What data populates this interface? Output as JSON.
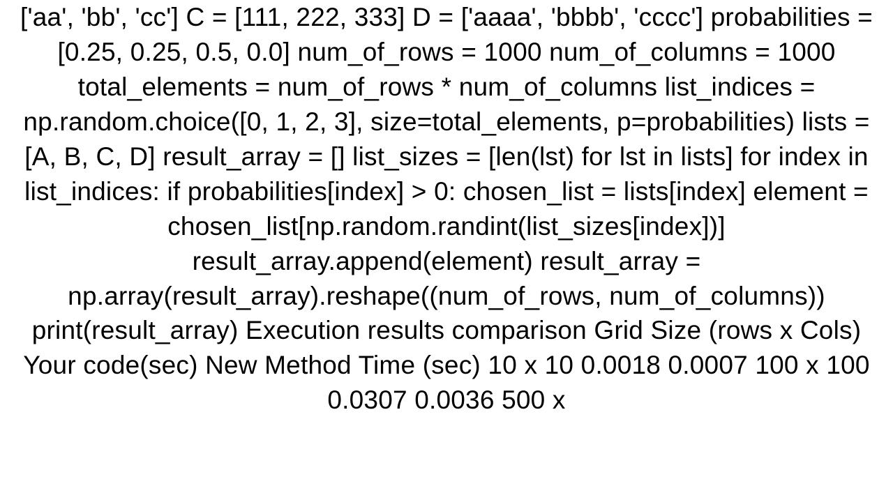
{
  "document": {
    "text": "['aa', 'bb', 'cc'] C = [111, 222, 333] D = ['aaaa', 'bbbb', 'cccc']  probabilities = [0.25, 0.25, 0.5, 0.0]  num_of_rows = 1000 num_of_columns = 1000 total_elements = num_of_rows * num_of_columns  list_indices = np.random.choice([0, 1, 2, 3], size=total_elements, p=probabilities)  lists = [A, B, C, D]  result_array = []  list_sizes = [len(lst) for lst in lists]  for index in list_indices:     if probabilities[index] > 0:         chosen_list = lists[index]         element = chosen_list[np.random.randint(list_sizes[index])]         result_array.append(element)  result_array = np.array(result_array).reshape((num_of_rows, num_of_columns))  print(result_array)  Execution results comparison Grid Size (rows x Cols) Your code(sec)  New Method Time (sec) 10 x 10               0.0018               0.0007 100 x 100             0.0307         0.0036 500 x"
  }
}
